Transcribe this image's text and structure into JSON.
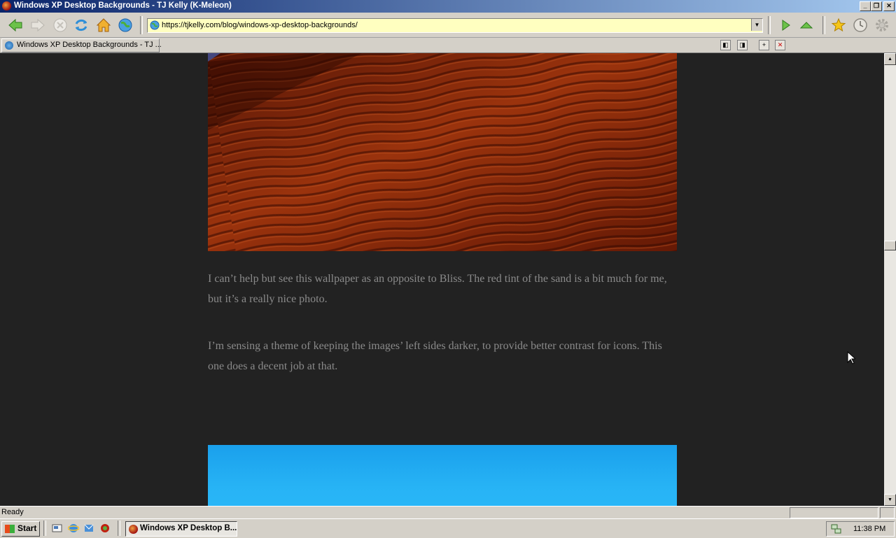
{
  "window": {
    "title": "Windows XP Desktop Backgrounds - TJ Kelly (K-Meleon)",
    "buttons": {
      "minimize": "_",
      "maximize": "❐",
      "close": "✕"
    }
  },
  "toolbar": {
    "back": "back-arrow-icon",
    "forward": "forward-arrow-icon",
    "stop": "stop-icon",
    "reload": "reload-icon",
    "home": "home-icon",
    "go_globe": "globe-icon",
    "url": "https://tjkelly.com/blog/windows-xp-desktop-backgrounds/",
    "go": "play-icon",
    "up": "up-arrow-icon",
    "bookmark": "star-icon",
    "history": "clock-icon",
    "settings": "gear-icon"
  },
  "tabs": [
    {
      "label": "Windows XP Desktop Backgrounds - TJ ..."
    }
  ],
  "article": {
    "paragraphs": [
      "I can’t help but see this wallpaper as an opposite to Bliss. The red tint of the sand is a bit much for me, but it’s a really nice photo.",
      "I’m sensing a theme of keeping the images’ left sides darker, to provide better contrast for icons. This one does a decent job at that."
    ]
  },
  "statusbar": {
    "text": "Ready"
  },
  "taskbar": {
    "start_label": "Start",
    "task_item": "Windows XP Desktop B...",
    "clock": "11:38 PM"
  },
  "colors": {
    "page_bg": "#222222",
    "text": "#8a8a8a",
    "url_bg": "#ffffc0",
    "title_start": "#0a246a",
    "title_end": "#a6caf0"
  }
}
